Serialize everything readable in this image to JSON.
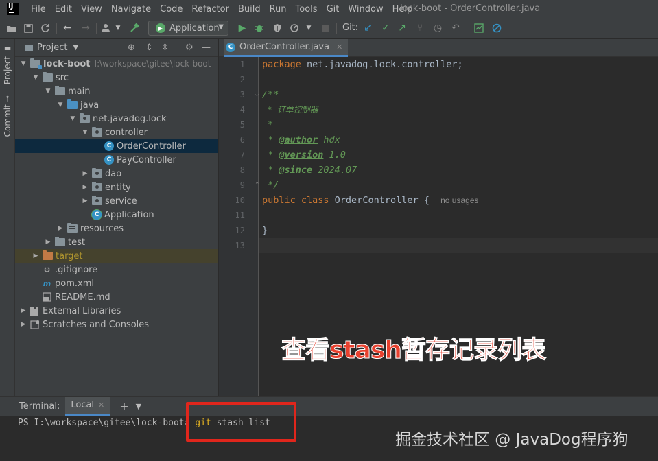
{
  "menubar": {
    "items": [
      "File",
      "Edit",
      "View",
      "Navigate",
      "Code",
      "Refactor",
      "Build",
      "Run",
      "Tools",
      "Git",
      "Window",
      "Help"
    ],
    "window_title": "lock-boot - OrderController.java"
  },
  "toolbar": {
    "run_config": "Application",
    "git_label": "Git:"
  },
  "sidestrip": {
    "project_tab": "Project",
    "commit_tab": "Commit"
  },
  "project_panel": {
    "title": "Project",
    "tree": [
      {
        "label": "lock-boot",
        "hint": "I:\\workspace\\gitee\\lock-boot"
      },
      {
        "label": "src"
      },
      {
        "label": "main"
      },
      {
        "label": "java"
      },
      {
        "label": "net.javadog.lock"
      },
      {
        "label": "controller"
      },
      {
        "label": "OrderController"
      },
      {
        "label": "PayController"
      },
      {
        "label": "dao"
      },
      {
        "label": "entity"
      },
      {
        "label": "service"
      },
      {
        "label": "Application"
      },
      {
        "label": "resources"
      },
      {
        "label": "test"
      },
      {
        "label": "target"
      },
      {
        "label": ".gitignore"
      },
      {
        "label": "pom.xml"
      },
      {
        "label": "README.md"
      },
      {
        "label": "External Libraries"
      },
      {
        "label": "Scratches and Consoles"
      }
    ]
  },
  "editor": {
    "tab_label": "OrderController.java",
    "line_numbers": [
      "1",
      "2",
      "3",
      "4",
      "5",
      "6",
      "7",
      "8",
      "9",
      "10",
      "11",
      "12",
      "13"
    ],
    "code": {
      "l1_kw": "package",
      "l1_rest": " net.javadog.lock.controller;",
      "l3": "/**",
      "l4": " * 订单控制器",
      "l5": " *",
      "l6_pre": " * ",
      "l6_tag": "@author",
      "l6_val": " hdx",
      "l7_pre": " * ",
      "l7_tag": "@version",
      "l7_val": " 1.0",
      "l8_pre": " * ",
      "l8_tag": "@since",
      "l8_val": " 2024.07",
      "l9": " */",
      "l10_kw": "public class",
      "l10_cls": " OrderController {",
      "l10_hint": "no usages",
      "l12": "}"
    }
  },
  "overlay_caption": "查看stash暂存记录列表",
  "terminal": {
    "title": "Terminal:",
    "tab_label": "Local",
    "prompt": "PS I:\\workspace\\gitee\\lock-boot> ",
    "cmd_kw": "git",
    "cmd_rest": " stash list"
  },
  "watermark": "掘金技术社区 @ JavaDog程序狗",
  "colors": {
    "selection": "#0d293e",
    "accent": "#4a88c7",
    "keyword": "#cc7832",
    "doc_comment": "#629755",
    "overlay_text": "#e8412f",
    "highlight_box": "#e0261c"
  }
}
